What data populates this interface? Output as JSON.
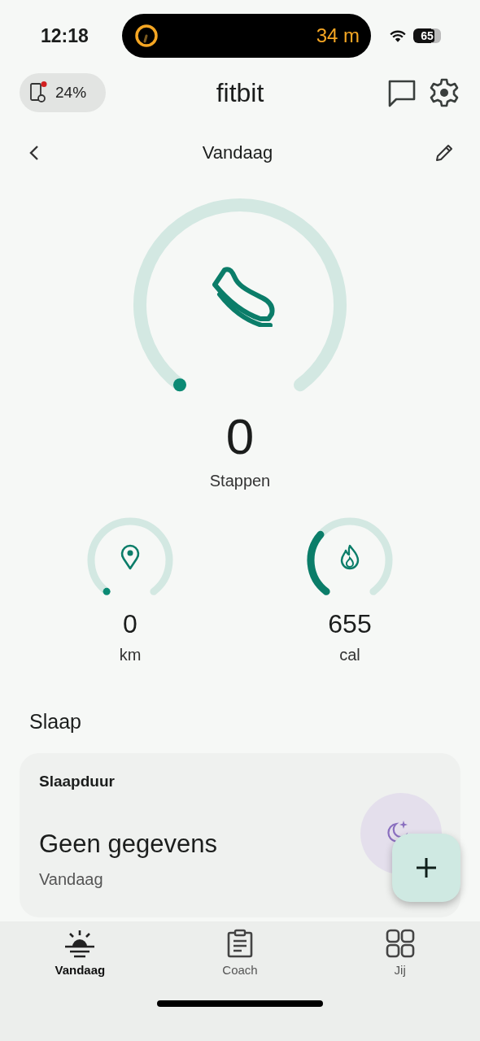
{
  "status_bar": {
    "time": "12:18",
    "activity": "34 m",
    "battery": "65"
  },
  "header": {
    "device_battery": "24%",
    "device_alert": true,
    "logo": "fitbit"
  },
  "date_nav": {
    "title": "Vandaag"
  },
  "steps": {
    "value": "0",
    "label": "Stappen"
  },
  "metrics": [
    {
      "kind": "distance",
      "value": "0",
      "unit": "km"
    },
    {
      "kind": "calories",
      "value": "655",
      "unit": "cal"
    }
  ],
  "sleep": {
    "heading": "Slaap",
    "card_title": "Slaapduur",
    "value": "Geen gegevens",
    "date": "Vandaag"
  },
  "tabs": [
    {
      "kind": "today",
      "label": "Vandaag",
      "selected": true
    },
    {
      "kind": "coach",
      "label": "Coach",
      "selected": false
    },
    {
      "kind": "you",
      "label": "Jij",
      "selected": false
    }
  ]
}
